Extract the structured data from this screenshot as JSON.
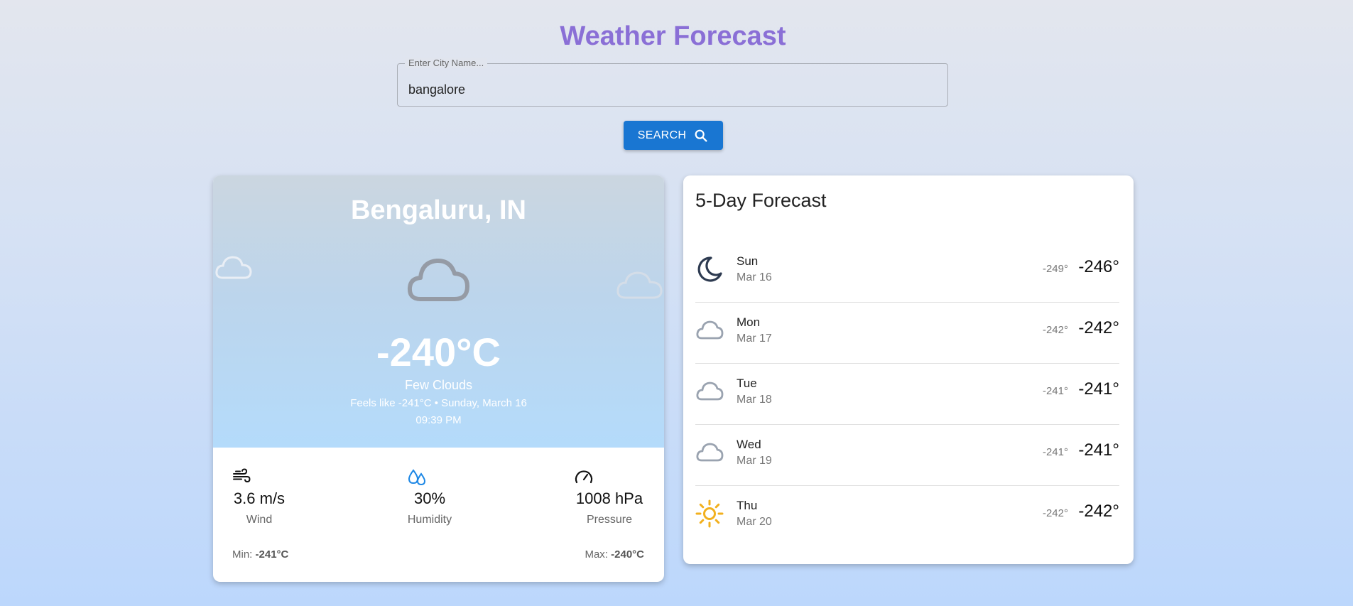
{
  "header": {
    "title": "Weather Forecast"
  },
  "search": {
    "label": "Enter City Name...",
    "value": "bangalore",
    "button_label": "SEARCH"
  },
  "current": {
    "city": "Bengaluru, IN",
    "temperature": "-240°C",
    "description": "Few Clouds",
    "feels_like": "Feels like -241°C • Sunday, March 16",
    "time": "09:39 PM",
    "icon": "cloud-icon",
    "stats": {
      "wind": {
        "value": "3.6 m/s",
        "label": "Wind",
        "icon": "wind-icon"
      },
      "humidity": {
        "value": "30%",
        "label": "Humidity",
        "icon": "humidity-icon"
      },
      "pressure": {
        "value": "1008 hPa",
        "label": "Pressure",
        "icon": "gauge-icon"
      }
    },
    "min_label": "Min:",
    "min_value": "-241°C",
    "max_label": "Max:",
    "max_value": "-240°C"
  },
  "forecast": {
    "title": "5-Day Forecast",
    "days": [
      {
        "day": "Sun",
        "date": "Mar 16",
        "low": "-249°",
        "high": "-246°",
        "icon": "moon-icon"
      },
      {
        "day": "Mon",
        "date": "Mar 17",
        "low": "-242°",
        "high": "-242°",
        "icon": "cloud-icon"
      },
      {
        "day": "Tue",
        "date": "Mar 18",
        "low": "-241°",
        "high": "-241°",
        "icon": "cloud-icon"
      },
      {
        "day": "Wed",
        "date": "Mar 19",
        "low": "-241°",
        "high": "-241°",
        "icon": "cloud-icon"
      },
      {
        "day": "Thu",
        "date": "Mar 20",
        "low": "-242°",
        "high": "-242°",
        "icon": "sun-icon"
      }
    ]
  },
  "colors": {
    "title": "#8a6fd6",
    "button": "#1976d2",
    "moon": "#2d3a50",
    "cloud": "#9aa3b0",
    "sun": "#f2b01e",
    "humidity": "#1e88e5"
  }
}
